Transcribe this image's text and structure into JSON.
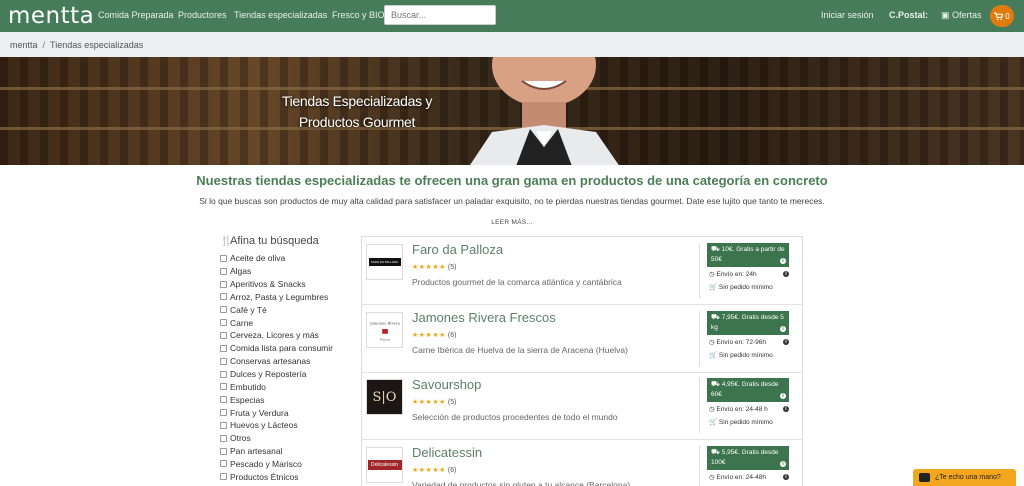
{
  "brand": {
    "logo": "mentta",
    "accent": "#477c5a",
    "orange": "#e07b0e"
  },
  "nav": {
    "links": [
      "Comida Preparada",
      "Productores",
      "Tiendas especializadas",
      "Fresco y BIO"
    ],
    "search_placeholder": "Buscar...",
    "login": "Iniciar sesión",
    "postal": "C.Postal:",
    "offers": "Ofertas",
    "cart_count": "0"
  },
  "breadcrumb": {
    "home": "mentta",
    "current": "Tiendas especializadas"
  },
  "hero": {
    "title": "Tiendas Especializadas y Productos Gourmet"
  },
  "intro": {
    "title": "Nuestras tiendas especializadas te ofrecen una gran gama en productos de una categoría en concreto",
    "text": "Si lo que buscas son productos de muy alta calidad para satisfacer un paladar exquisito, no te pierdas nuestras tiendas gourmet. Date ese lujito que tanto te mereces.",
    "more": "LEER MÁS..."
  },
  "filters": {
    "title": "Afina tu búsqueda",
    "items": [
      "Aceite de oliva",
      "Algas",
      "Aperitivos & Snacks",
      "Arroz, Pasta y Legumbres",
      "Café y Té",
      "Carne",
      "Cerveza, Licores y más",
      "Comida lista para consumir",
      "Conservas artesanas",
      "Dulces y Repostería",
      "Embutido",
      "Especias",
      "Fruta y Verdura",
      "Huevos y Lácteos",
      "Otros",
      "Pan artesanal",
      "Pescado y Marisco",
      "Productos Étnicos"
    ]
  },
  "stores": [
    {
      "name": "Faro da Palloza",
      "rating": 4.5,
      "stars": "★★★★★",
      "reviews": "(5)",
      "desc": "Productos gourmet de la comarca atlántica y cantábrica",
      "ship_line1": "10€. Gratis a partir de",
      "ship_line2": "50€",
      "eta": "Envío en: 24h",
      "min": "Sin pedido mínimo"
    },
    {
      "name": "Jamones Rivera Frescos",
      "rating": 4.5,
      "stars": "★★★★★",
      "reviews": "(6)",
      "desc": "Carne Ibérica de Huelva de la sierra de Aracena (Huelva)",
      "ship_line1": "7,95€. Gratis desde 5",
      "ship_line2": "kg",
      "eta": "Envío en: 72-96h",
      "min": "Sin pedido mínimo"
    },
    {
      "name": "Savourshop",
      "rating": 4.5,
      "stars": "★★★★★",
      "reviews": "(5)",
      "desc": "Selección de productos procedentes de todo el mundo",
      "ship_line1": "4,95€. Gratis desde",
      "ship_line2": "60€",
      "eta": "Envío en: 24-48 h",
      "min": "Sin pedido mínimo"
    },
    {
      "name": "Delicatessin",
      "rating": 5,
      "stars": "★★★★★",
      "reviews": "(6)",
      "desc": "Variedad de productos sin gluten a tu alcance (Barcelona)",
      "ship_line1": "5,95€. Gratis desde",
      "ship_line2": "100€",
      "eta": "Envío en: 24-48h",
      "min": ""
    }
  ],
  "thumbs": {
    "faro": "FARO DA PALLOZA",
    "savour": "S|O",
    "deli": "Delicatessin"
  },
  "help": {
    "label": "¿Te echo una mano?"
  }
}
